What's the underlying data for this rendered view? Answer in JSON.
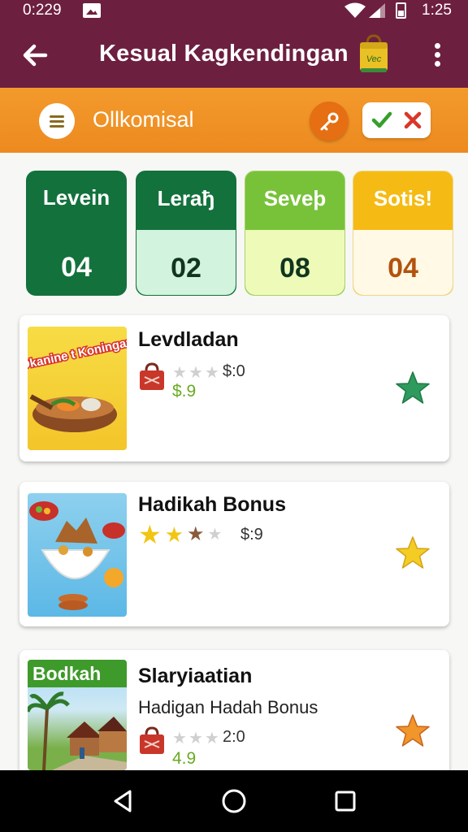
{
  "status_bar": {
    "time": "0:229",
    "clock": "1:25"
  },
  "app_bar": {
    "title": "Kesual Kagkendingan",
    "bag_label": "Vec"
  },
  "tool_bar": {
    "title": "Ollkomisal"
  },
  "stats": [
    {
      "label": "Levein",
      "value": "04"
    },
    {
      "label": "Leraђ",
      "value": "02"
    },
    {
      "label": "Seveþ",
      "value": "08"
    },
    {
      "label": "Sotis!",
      "value": "04"
    }
  ],
  "cards": [
    {
      "title": "Levdladan",
      "thumb_text": "Okanine t Koningan",
      "price": "$:0",
      "value": "$.9",
      "rating": 0,
      "star_color": "#2e9a5e"
    },
    {
      "title": "Hadikah Bonus",
      "price": "$:9",
      "rating": 2,
      "star_color": "#f3cd24"
    },
    {
      "title": "Slaryiaatian",
      "subtitle": "Hadigan Hadah Bonus",
      "thumb_badge": "Bodkah",
      "price": "2:0",
      "value": "4.9",
      "rating": 0,
      "star_color": "#f0962a"
    }
  ],
  "colors": {
    "primary": "#6d1f3f",
    "accent": "#ef8f24"
  }
}
